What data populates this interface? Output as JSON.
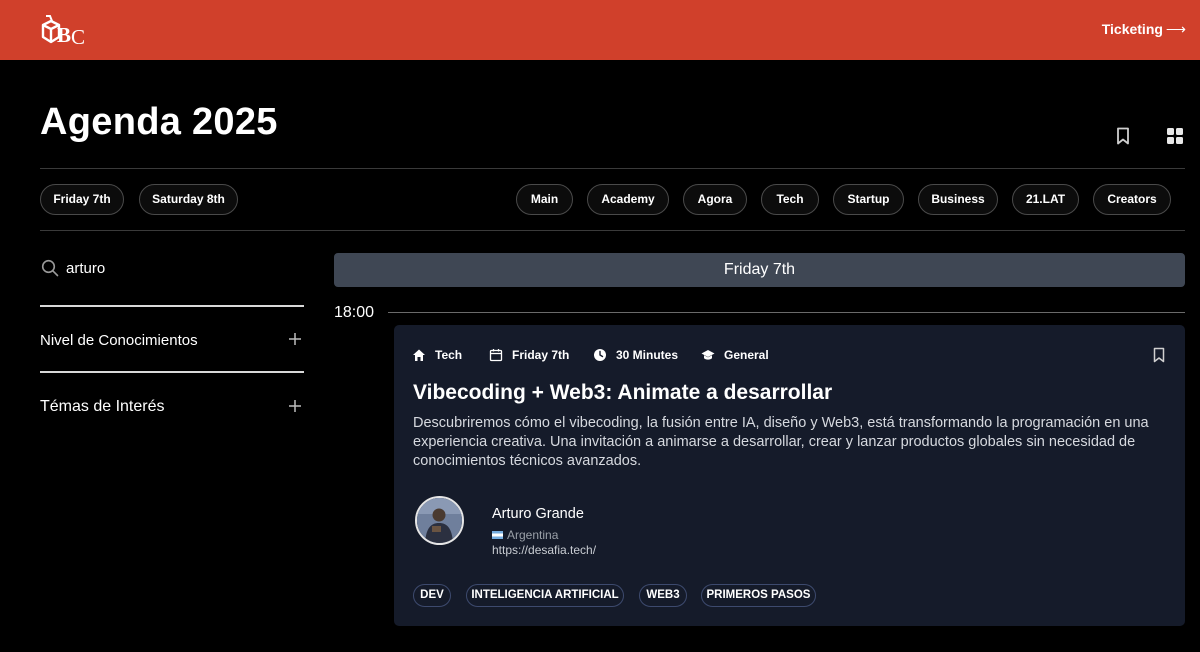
{
  "header": {
    "logo_icon": "abc-cube-logo",
    "ticketing_label": "Ticketing",
    "ticketing_arrow": "⟶",
    "bg_color": "#d0402b"
  },
  "page": {
    "title": "Agenda 2025",
    "bookmark_icon": "bookmark-icon",
    "grid_icon": "grid-icon"
  },
  "days": [
    {
      "label": "Friday 7th"
    },
    {
      "label": "Saturday 8th"
    }
  ],
  "stages": [
    {
      "label": "Main"
    },
    {
      "label": "Academy"
    },
    {
      "label": "Agora"
    },
    {
      "label": "Tech"
    },
    {
      "label": "Startup"
    },
    {
      "label": "Business"
    },
    {
      "label": "21.LAT"
    },
    {
      "label": "Creators"
    }
  ],
  "sidebar": {
    "search_value": "arturo",
    "filters": [
      {
        "label": "Nivel de Conocimientos"
      },
      {
        "label": "Témas de Interés"
      }
    ]
  },
  "schedule": {
    "day_header": "Friday 7th",
    "time": "18:00",
    "session": {
      "meta": [
        {
          "icon": "home-icon",
          "label": "Tech"
        },
        {
          "icon": "calendar-icon",
          "label": "Friday 7th"
        },
        {
          "icon": "clock-icon",
          "label": "30 Minutes"
        },
        {
          "icon": "graduation-cap-icon",
          "label": "General"
        }
      ],
      "title": "Vibecoding + Web3: Animate a desarrollar",
      "description": "Descubriremos cómo el vibecoding, la fusión entre IA, diseño y Web3, está transformando la programación en una experiencia creativa. Una invitación a animarse a desarrollar, crear y lanzar productos globales sin necesidad de conocimientos técnicos avanzados.",
      "speaker": {
        "name": "Arturo Grande",
        "country": "Argentina",
        "url": "https://desafia.tech/"
      },
      "tags": [
        "DEV",
        "INTELIGENCIA ARTIFICIAL",
        "WEB3",
        "PRIMEROS PASOS"
      ]
    }
  }
}
